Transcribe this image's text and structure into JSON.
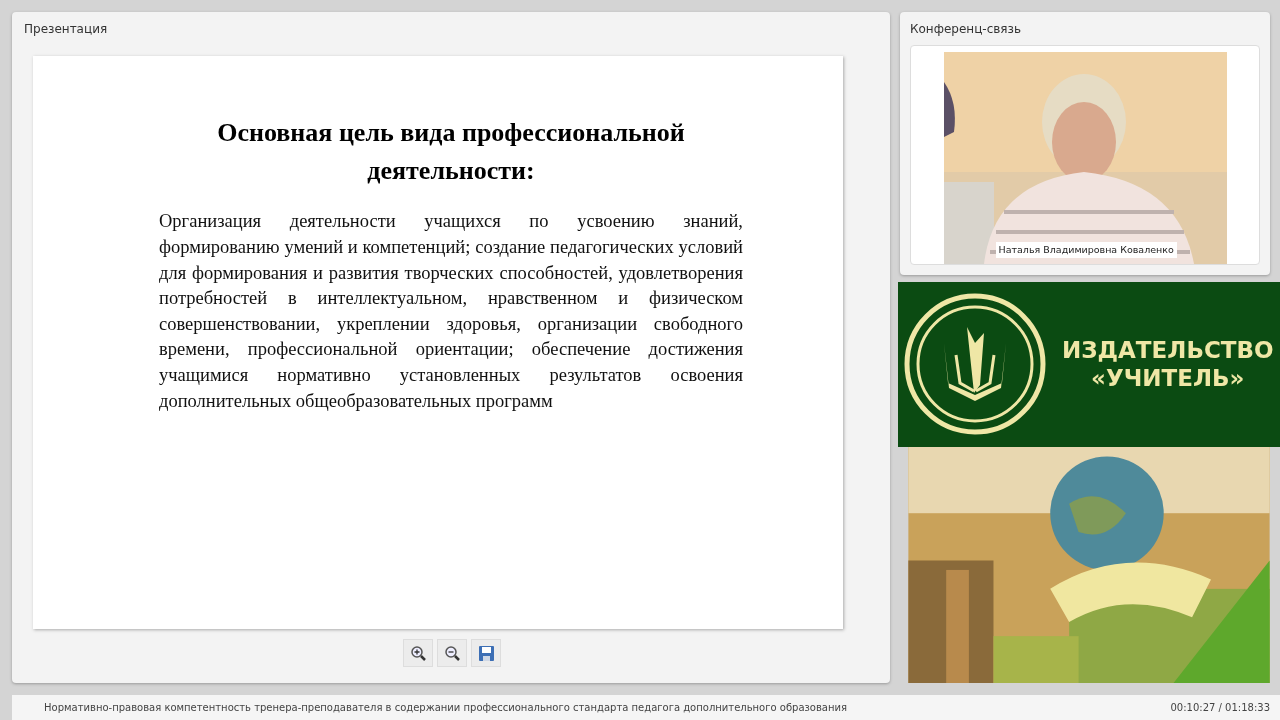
{
  "presentation": {
    "title": "Презентация",
    "slide": {
      "heading": "Основная цель вида профессиональной деятельности:",
      "body": "Организация деятельности учащихся по усвоению знаний, формированию умений и компетенций; создание педагогических условий для формирования и развития творческих способностей, удовлетворения потребностей в интеллектуальном, нравственном и физическом совершенствовании, укреплении здоровья, организации свободного времени, профессиональной ориентации; обеспечение достижения учащимися нормативно установленных результатов освоения дополнительных общеобразовательных программ"
    },
    "tools": [
      {
        "kind": "zoom-in"
      },
      {
        "kind": "zoom-out"
      },
      {
        "kind": "save"
      }
    ]
  },
  "conference": {
    "title": "Конференц-связь",
    "speaker": "Наталья Владимировна Коваленко"
  },
  "banner": {
    "lines": [
      "ИЗДАТЕЛЬСТВО",
      "«УЧИТЕЛЬ»"
    ]
  },
  "footer": {
    "course": "Нормативно-правовая компетентность тренера-преподавателя в содержании профессионального стандарта педагога дополнительного образования",
    "time": "00:10:27 / 01:18:33"
  }
}
